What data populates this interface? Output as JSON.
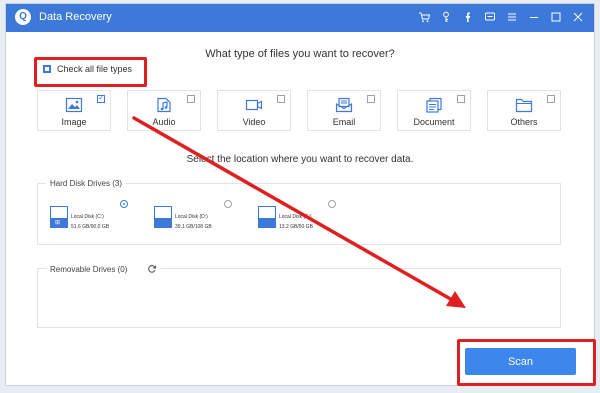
{
  "app": {
    "title": "Data Recovery",
    "logo_glyph": "Q"
  },
  "titlebar_icons": [
    "cart-icon",
    "key-icon",
    "facebook-icon",
    "feedback-icon",
    "menu-icon",
    "minimize-icon",
    "maximize-icon",
    "close-icon"
  ],
  "question": "What type of files you want to recover?",
  "check_all": {
    "label": "Check all file types",
    "checked": true
  },
  "file_types": [
    {
      "label": "Image",
      "icon": "image-icon",
      "checked": true
    },
    {
      "label": "Audio",
      "icon": "audio-icon",
      "checked": false
    },
    {
      "label": "Video",
      "icon": "video-icon",
      "checked": false
    },
    {
      "label": "Email",
      "icon": "email-icon",
      "checked": false
    },
    {
      "label": "Document",
      "icon": "document-icon",
      "checked": false
    },
    {
      "label": "Others",
      "icon": "others-icon",
      "checked": false
    }
  ],
  "location_title": "Select the location where you want to recover data.",
  "hard_disk": {
    "label": "Hard Disk Drives (3)",
    "drives": [
      {
        "name": "Local Disk (C:)",
        "size": "51.6 GB/90.0 GB",
        "selected": true,
        "system": true
      },
      {
        "name": "Local Disk (D:)",
        "size": "39.1 GB/108 GB",
        "selected": false,
        "system": false
      },
      {
        "name": "Local Disk (E:)",
        "size": "13.2 GB/50 GB",
        "selected": false,
        "system": false
      }
    ]
  },
  "removable": {
    "label": "Removable Drives (0)"
  },
  "scan_label": "Scan",
  "colors": {
    "accent": "#3c79d8",
    "button": "#3c86ec",
    "annotation": "#e02020"
  }
}
